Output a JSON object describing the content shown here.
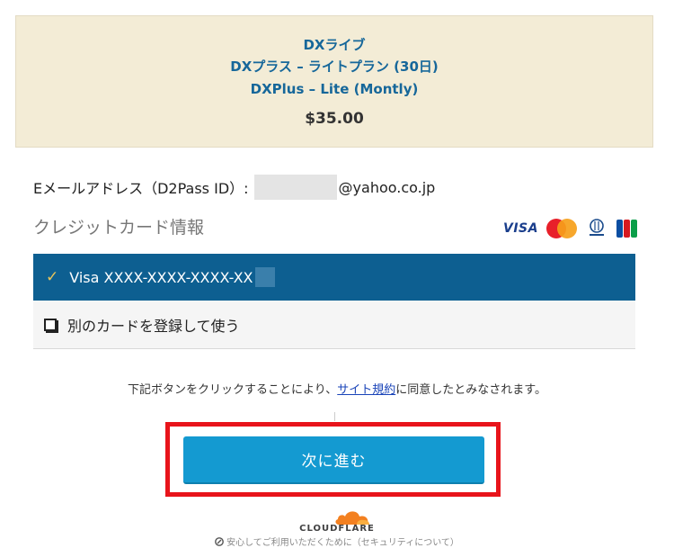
{
  "summary": {
    "line1": "DXライブ",
    "line2": "DXプラス – ライトプラン (30日)",
    "line3": "DXPlus – Lite (Montly)",
    "price": "$35.00"
  },
  "account": {
    "email_label": "Eメールアドレス（D2Pass ID）:",
    "email_domain": "@yahoo.co.jp"
  },
  "credit_card": {
    "title": "クレジットカード情報",
    "brands": [
      "VISA",
      "MasterCard",
      "Diners Club",
      "JCB"
    ],
    "saved_card": "Visa XXXX-XXXX-XXXX-XX",
    "use_other": "別のカードを登録して使う"
  },
  "agreement": {
    "before": "下記ボタンをクリックすることにより、",
    "link": "サイト規約",
    "after": "に同意したとみなされます。"
  },
  "next_button": "次に進む",
  "cloudflare": {
    "brand": "CLOUDFLARE",
    "note": "安心してご利用いただくために（セキュリティについて）"
  },
  "colors": {
    "summary_bg": "#f3ecd6",
    "selected_bg": "#0d5f91",
    "button_bg": "#149ad1",
    "highlight": "#e8141b",
    "link": "#1a44b8"
  }
}
